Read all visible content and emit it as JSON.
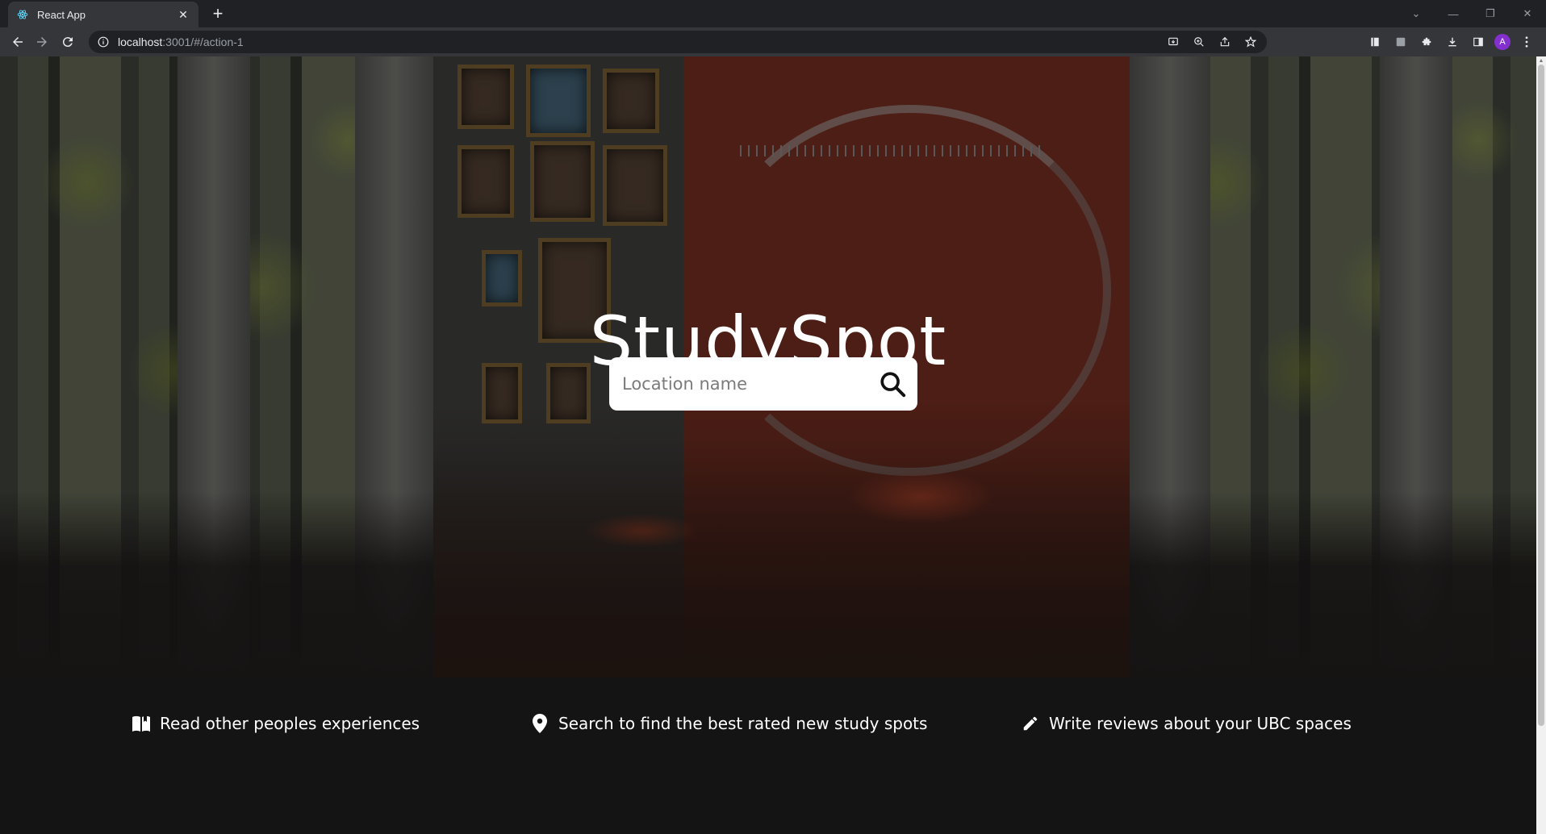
{
  "browser": {
    "tab_title": "React App",
    "url_host": "localhost",
    "url_rest": ":3001/#/action-1",
    "avatar_letter": "A"
  },
  "hero": {
    "title": "StudySpot",
    "search_placeholder": "Location name"
  },
  "features": [
    {
      "icon": "book-open-icon",
      "text": "Read other peoples experiences"
    },
    {
      "icon": "location-pin-icon",
      "text": "Search to find the best rated new study spots"
    },
    {
      "icon": "pencil-icon",
      "text": "Write reviews about your UBC spaces"
    }
  ],
  "colors": {
    "page_bg": "#141414",
    "text": "#ffffff",
    "search_bg": "#ffffff",
    "chrome_dark": "#202124",
    "chrome_light": "#35363a",
    "avatar": "#8430ce"
  }
}
